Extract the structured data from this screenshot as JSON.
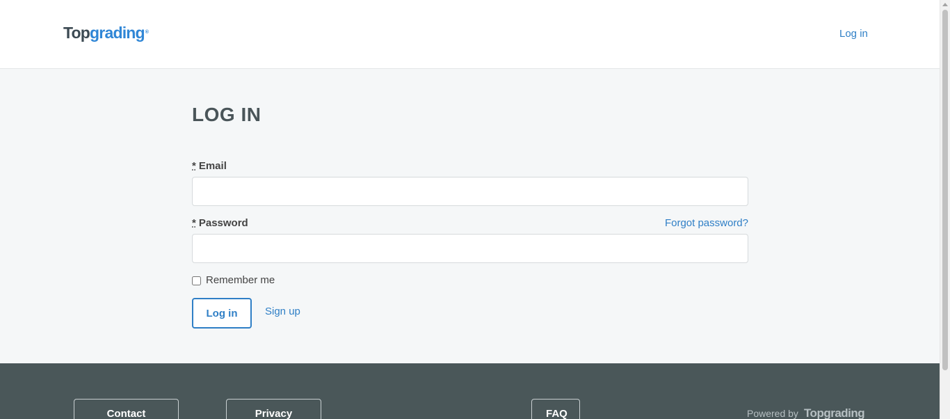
{
  "header": {
    "logo_top": "Top",
    "logo_grading": "grading",
    "logo_tm": "®",
    "login_link": "Log in"
  },
  "main": {
    "title": "LOG IN",
    "email": {
      "required_mark": "*",
      "label": "Email",
      "value": "",
      "placeholder": ""
    },
    "password": {
      "required_mark": "*",
      "label": "Password",
      "value": "",
      "placeholder": "",
      "forgot_link": "Forgot password?"
    },
    "remember_label": "Remember me",
    "login_button": "Log in",
    "signup_link": "Sign up"
  },
  "footer": {
    "contact_support": "Contact Support",
    "privacy_policy": "Privacy Policy",
    "faq": "FAQ",
    "powered_by": "Powered by",
    "powered_logo": "Topgrading"
  },
  "colors": {
    "accent": "#2f7fc6",
    "footer_bg": "#4a5759",
    "page_bg": "#f5f7f8"
  }
}
